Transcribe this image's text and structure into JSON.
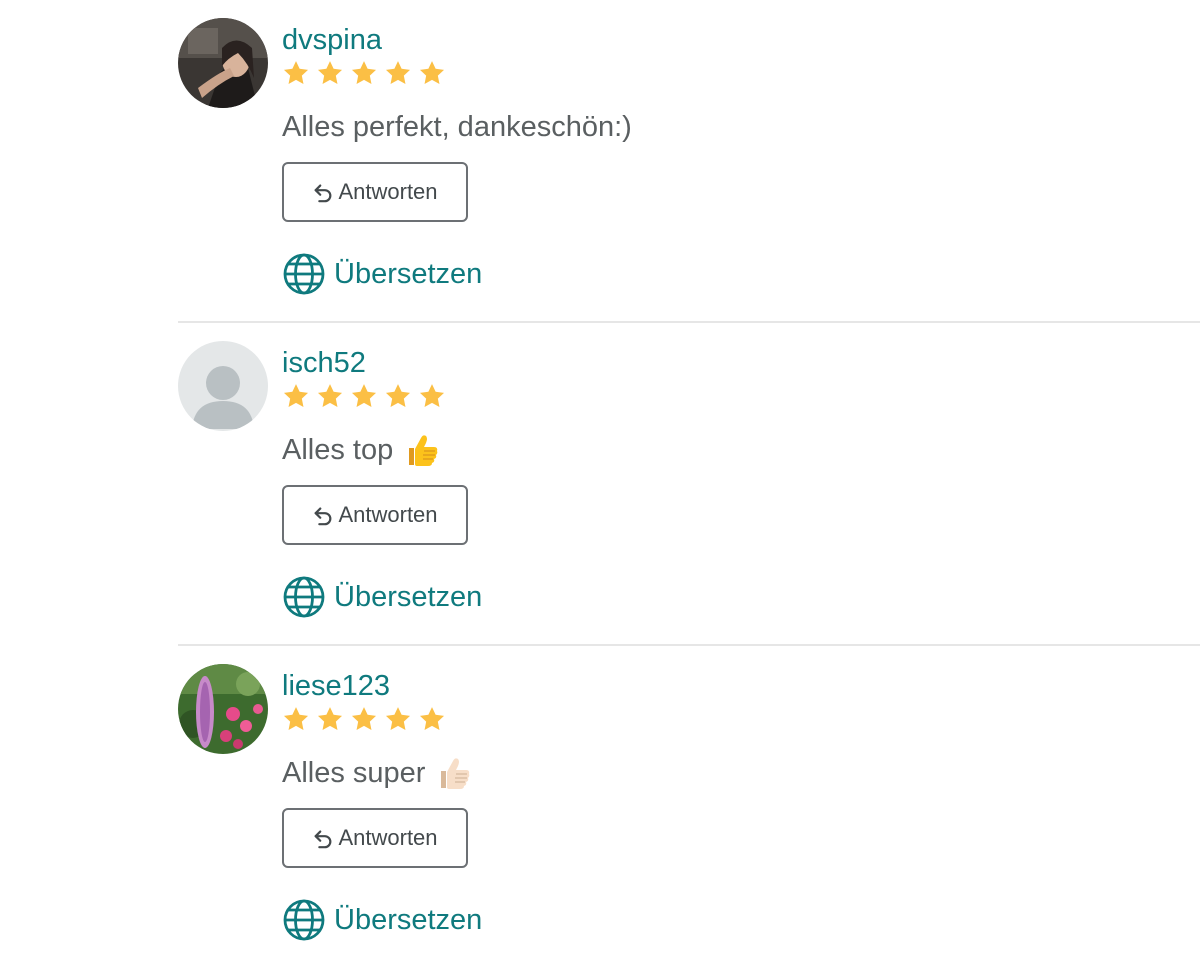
{
  "accent_color": "#0f7a7e",
  "star_color": "#fbbf45",
  "reviews": [
    {
      "username": "dvspina",
      "rating": 5,
      "text": "Alles perfekt, dankeschön:)",
      "emoji": "",
      "avatar": "user-photo",
      "reply_label": "Antworten",
      "translate_label": "Übersetzen"
    },
    {
      "username": "isch52",
      "rating": 5,
      "text": "Alles top",
      "emoji": "thumbs-up-icon",
      "avatar": "default-avatar",
      "reply_label": "Antworten",
      "translate_label": "Übersetzen"
    },
    {
      "username": "liese123",
      "rating": 5,
      "text": "Alles super",
      "emoji": "thumbs-up-light-icon",
      "avatar": "flower-photo",
      "reply_label": "Antworten",
      "translate_label": "Übersetzen"
    }
  ]
}
